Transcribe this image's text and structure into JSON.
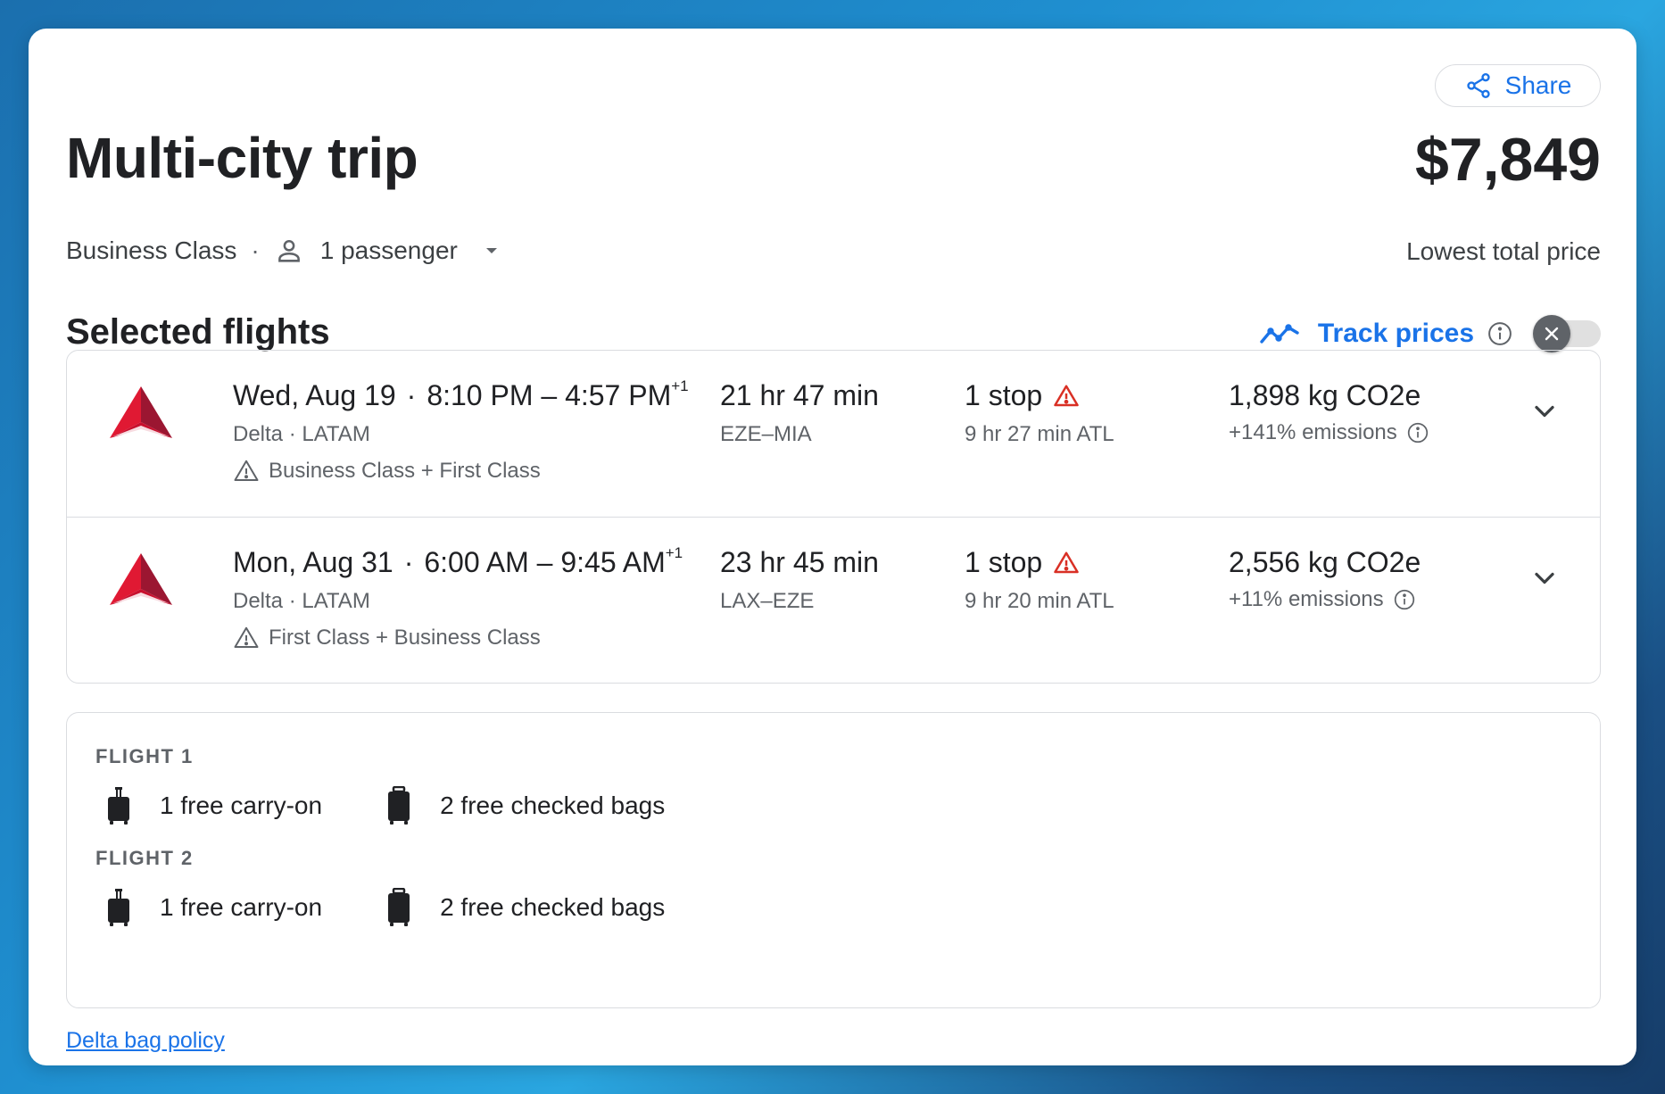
{
  "header": {
    "share_label": "Share",
    "title": "Multi-city trip",
    "cabin_class": "Business Class",
    "passengers": "1 passenger",
    "price": "$7,849",
    "price_label": "Lowest total price"
  },
  "section": {
    "title": "Selected flights",
    "track_prices_label": "Track prices",
    "track_prices_enabled": false
  },
  "flights": [
    {
      "date": "Wed, Aug 19",
      "time_range": "8:10 PM – 4:57 PM",
      "day_offset": "+1",
      "airlines": "Delta · LATAM",
      "cabin_note": "Business Class + First Class",
      "duration": "21 hr 47 min",
      "route": "EZE–MIA",
      "stops": "1 stop",
      "layover": "9 hr 27 min ATL",
      "co2": "1,898 kg CO2e",
      "emissions": "+141% emissions"
    },
    {
      "date": "Mon, Aug 31",
      "time_range": "6:00 AM – 9:45 AM",
      "day_offset": "+1",
      "airlines": "Delta · LATAM",
      "cabin_note": "First Class + Business Class",
      "duration": "23 hr 45 min",
      "route": "LAX–EZE",
      "stops": "1 stop",
      "layover": "9 hr 20 min ATL",
      "co2": "2,556 kg CO2e",
      "emissions": "+11% emissions"
    }
  ],
  "bags": [
    {
      "title": "FLIGHT 1",
      "carry_on": "1 free carry-on",
      "checked": "2 free checked bags"
    },
    {
      "title": "FLIGHT 2",
      "carry_on": "1 free carry-on",
      "checked": "2 free checked bags"
    }
  ],
  "bag_policy_link": "Delta bag policy",
  "colors": {
    "accent": "#1a73e8",
    "warning": "#d93025",
    "delta_red": "#e01933",
    "delta_dark": "#9b1631"
  }
}
